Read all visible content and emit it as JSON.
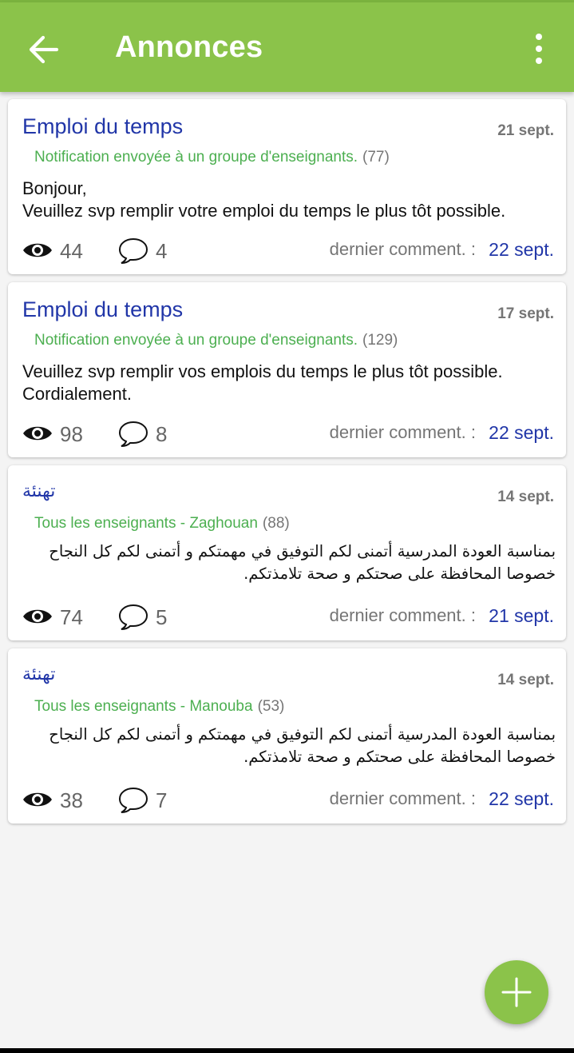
{
  "app_bar": {
    "title": "Annonces",
    "back_icon": "arrow-left-icon",
    "menu_icon": "more-vertical-icon",
    "color": "#8bc34a"
  },
  "announcements": [
    {
      "title": "Emploi du temps",
      "date": "21 sept.",
      "target": "Notification envoyée à un groupe d'enseignants.",
      "target_count": "(77)",
      "body": [
        "Bonjour,",
        "Veuillez svp remplir votre emploi du temps le plus tôt possible."
      ],
      "views": "44",
      "comments": "4",
      "last_comment_label": "dernier comment. :",
      "last_comment_date": "22 sept."
    },
    {
      "title": "Emploi du temps",
      "date": "17 sept.",
      "target": "Notification envoyée à un groupe d'enseignants.",
      "target_count": "(129)",
      "body": [
        "Veuillez svp remplir vos emplois du temps le plus tôt possible.",
        "Cordialement."
      ],
      "views": "98",
      "comments": "8",
      "last_comment_label": "dernier comment. :",
      "last_comment_date": "22 sept."
    },
    {
      "title": "تهنئة",
      "date": "14 sept.",
      "target": "Tous les enseignants - Zaghouan",
      "target_count": "(88)",
      "body": [
        "بمناسبة العودة المدرسية أتمنى لكم التوفيق في مهمتكم و أتمنى لكم كل النجاح",
        "خصوصا المحافظة على صحتكم و صحة تلامذتكم."
      ],
      "views": "74",
      "comments": "5",
      "last_comment_label": "dernier comment. :",
      "last_comment_date": "21 sept."
    },
    {
      "title": "تهنئة",
      "date": "14 sept.",
      "target": "Tous les enseignants - Manouba",
      "target_count": "(53)",
      "body": [
        "بمناسبة العودة المدرسية أتمنى لكم التوفيق في مهمتكم و أتمنى لكم كل النجاح",
        "خصوصا المحافظة على صحتكم و صحة تلامذتكم."
      ],
      "views": "38",
      "comments": "7",
      "last_comment_label": "dernier comment. :",
      "last_comment_date": "22 sept."
    }
  ],
  "fab": {
    "icon": "plus-icon"
  },
  "colors": {
    "title_blue": "#2136a8",
    "target_green": "#4caf50",
    "muted_gray": "#757575"
  }
}
